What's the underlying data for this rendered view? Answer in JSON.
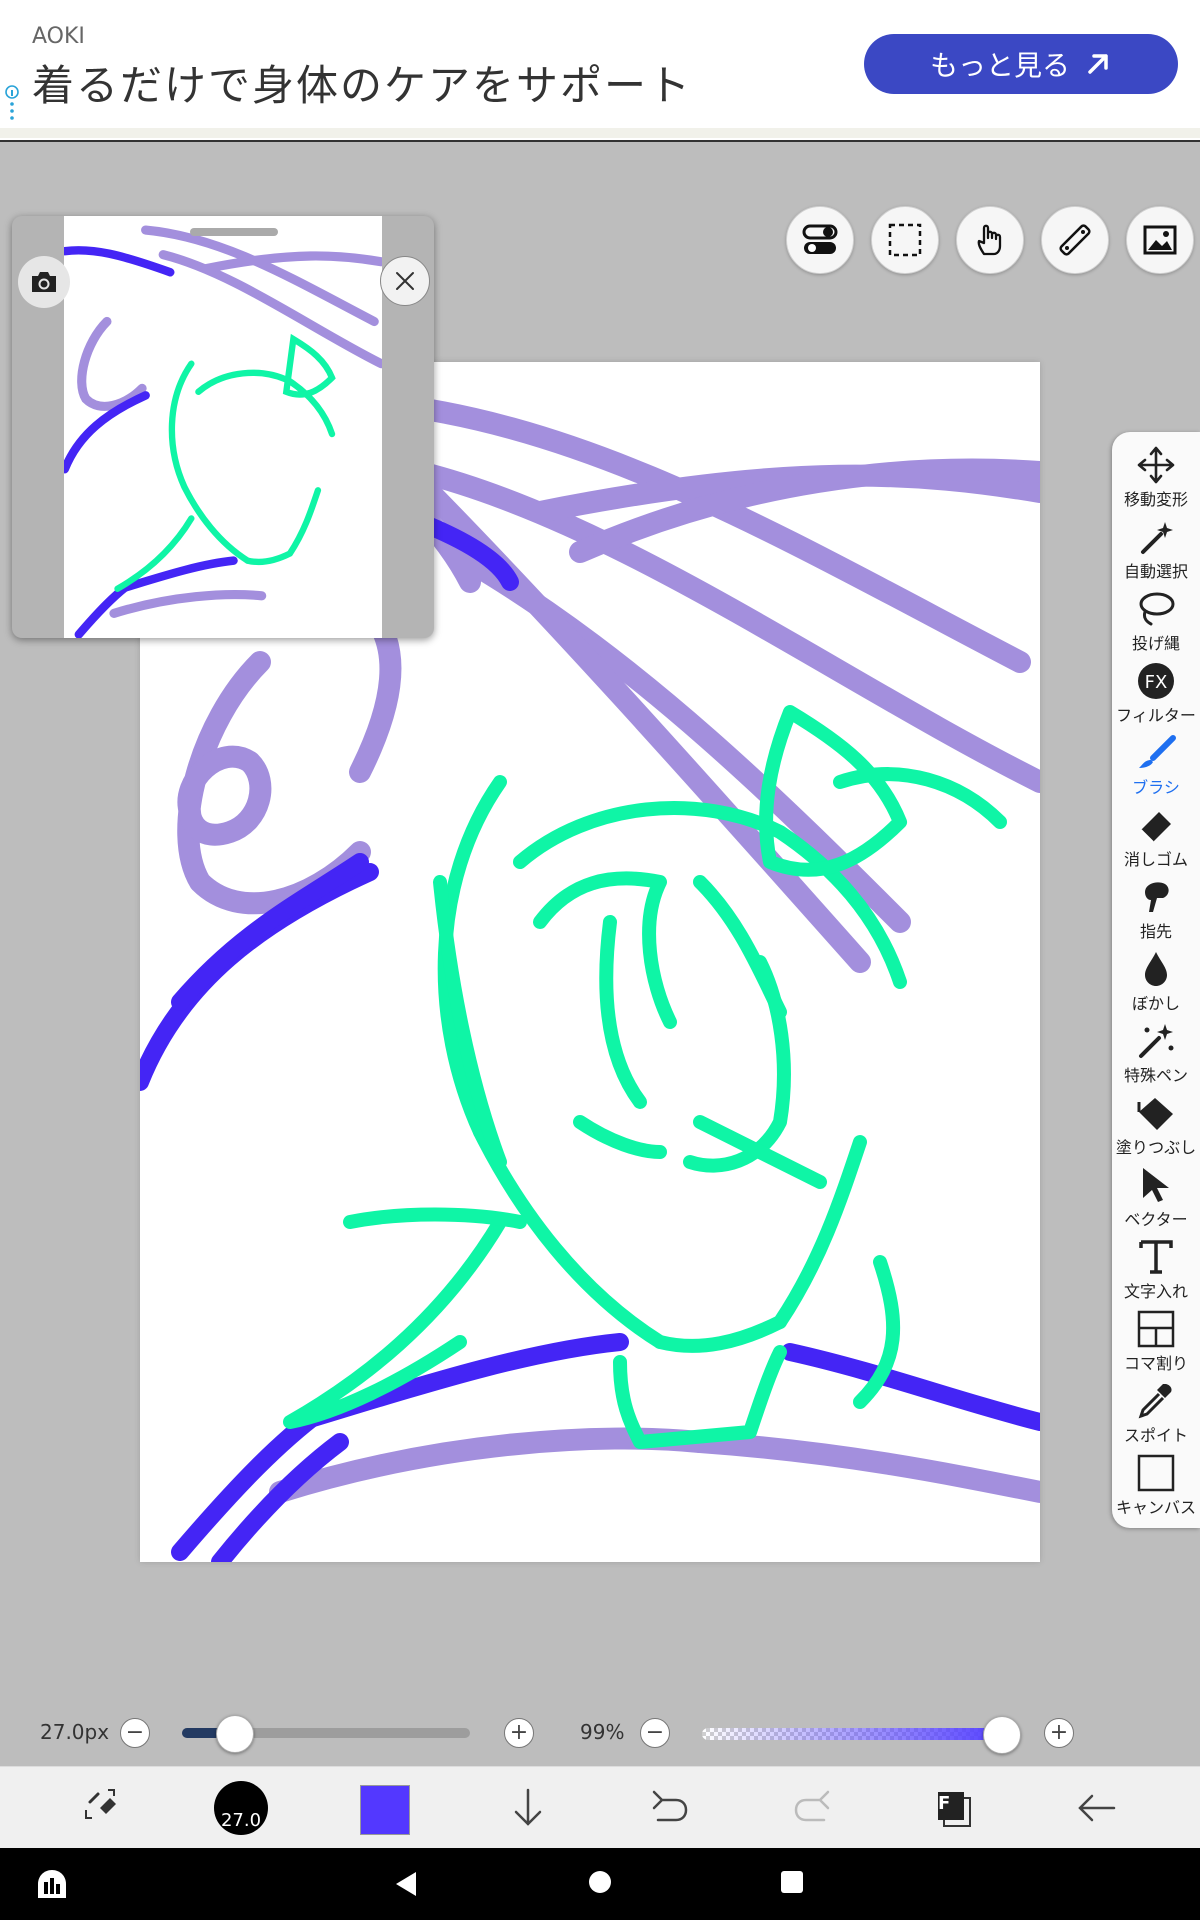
{
  "ad": {
    "brand": "AOKI",
    "headline": "着るだけで身体のケアをサポート",
    "cta": "もっと見る"
  },
  "toolbar_top": [
    {
      "name": "toggle-icon"
    },
    {
      "name": "selection-icon"
    },
    {
      "name": "hand-icon"
    },
    {
      "name": "ruler-icon"
    },
    {
      "name": "image-icon"
    }
  ],
  "side_tools": [
    {
      "label": "移動変形",
      "icon": "move-icon"
    },
    {
      "label": "自動選択",
      "icon": "magic-wand-icon"
    },
    {
      "label": "投げ縄",
      "icon": "lasso-icon"
    },
    {
      "label": "フィルター",
      "icon": "fx-icon"
    },
    {
      "label": "ブラシ",
      "icon": "brush-icon",
      "active": true
    },
    {
      "label": "消しゴム",
      "icon": "eraser-icon"
    },
    {
      "label": "指先",
      "icon": "finger-icon"
    },
    {
      "label": "ぼかし",
      "icon": "blur-icon"
    },
    {
      "label": "特殊ペン",
      "icon": "special-pen-icon"
    },
    {
      "label": "塗りつぶし",
      "icon": "fill-icon"
    },
    {
      "label": "ベクター",
      "icon": "vector-icon"
    },
    {
      "label": "文字入れ",
      "icon": "text-icon"
    },
    {
      "label": "コマ割り",
      "icon": "frame-divider-icon"
    },
    {
      "label": "スポイト",
      "icon": "eyedropper-icon"
    },
    {
      "label": "キャンバス",
      "icon": "canvas-icon"
    }
  ],
  "brush": {
    "size_label": "27.0px",
    "size_fraction": 0.18,
    "opacity_label": "99%",
    "opacity_fraction": 0.99,
    "preview_label": "27.0",
    "color": "#5338ff"
  },
  "bottom_bar": {
    "layer_label": "F"
  },
  "colors": {
    "ad_button": "#3b48c4",
    "accent_active": "#1e6ff0",
    "stroke_purple": "#a38fdd",
    "stroke_green": "#0ff5a6",
    "stroke_blue": "#4425f5"
  }
}
